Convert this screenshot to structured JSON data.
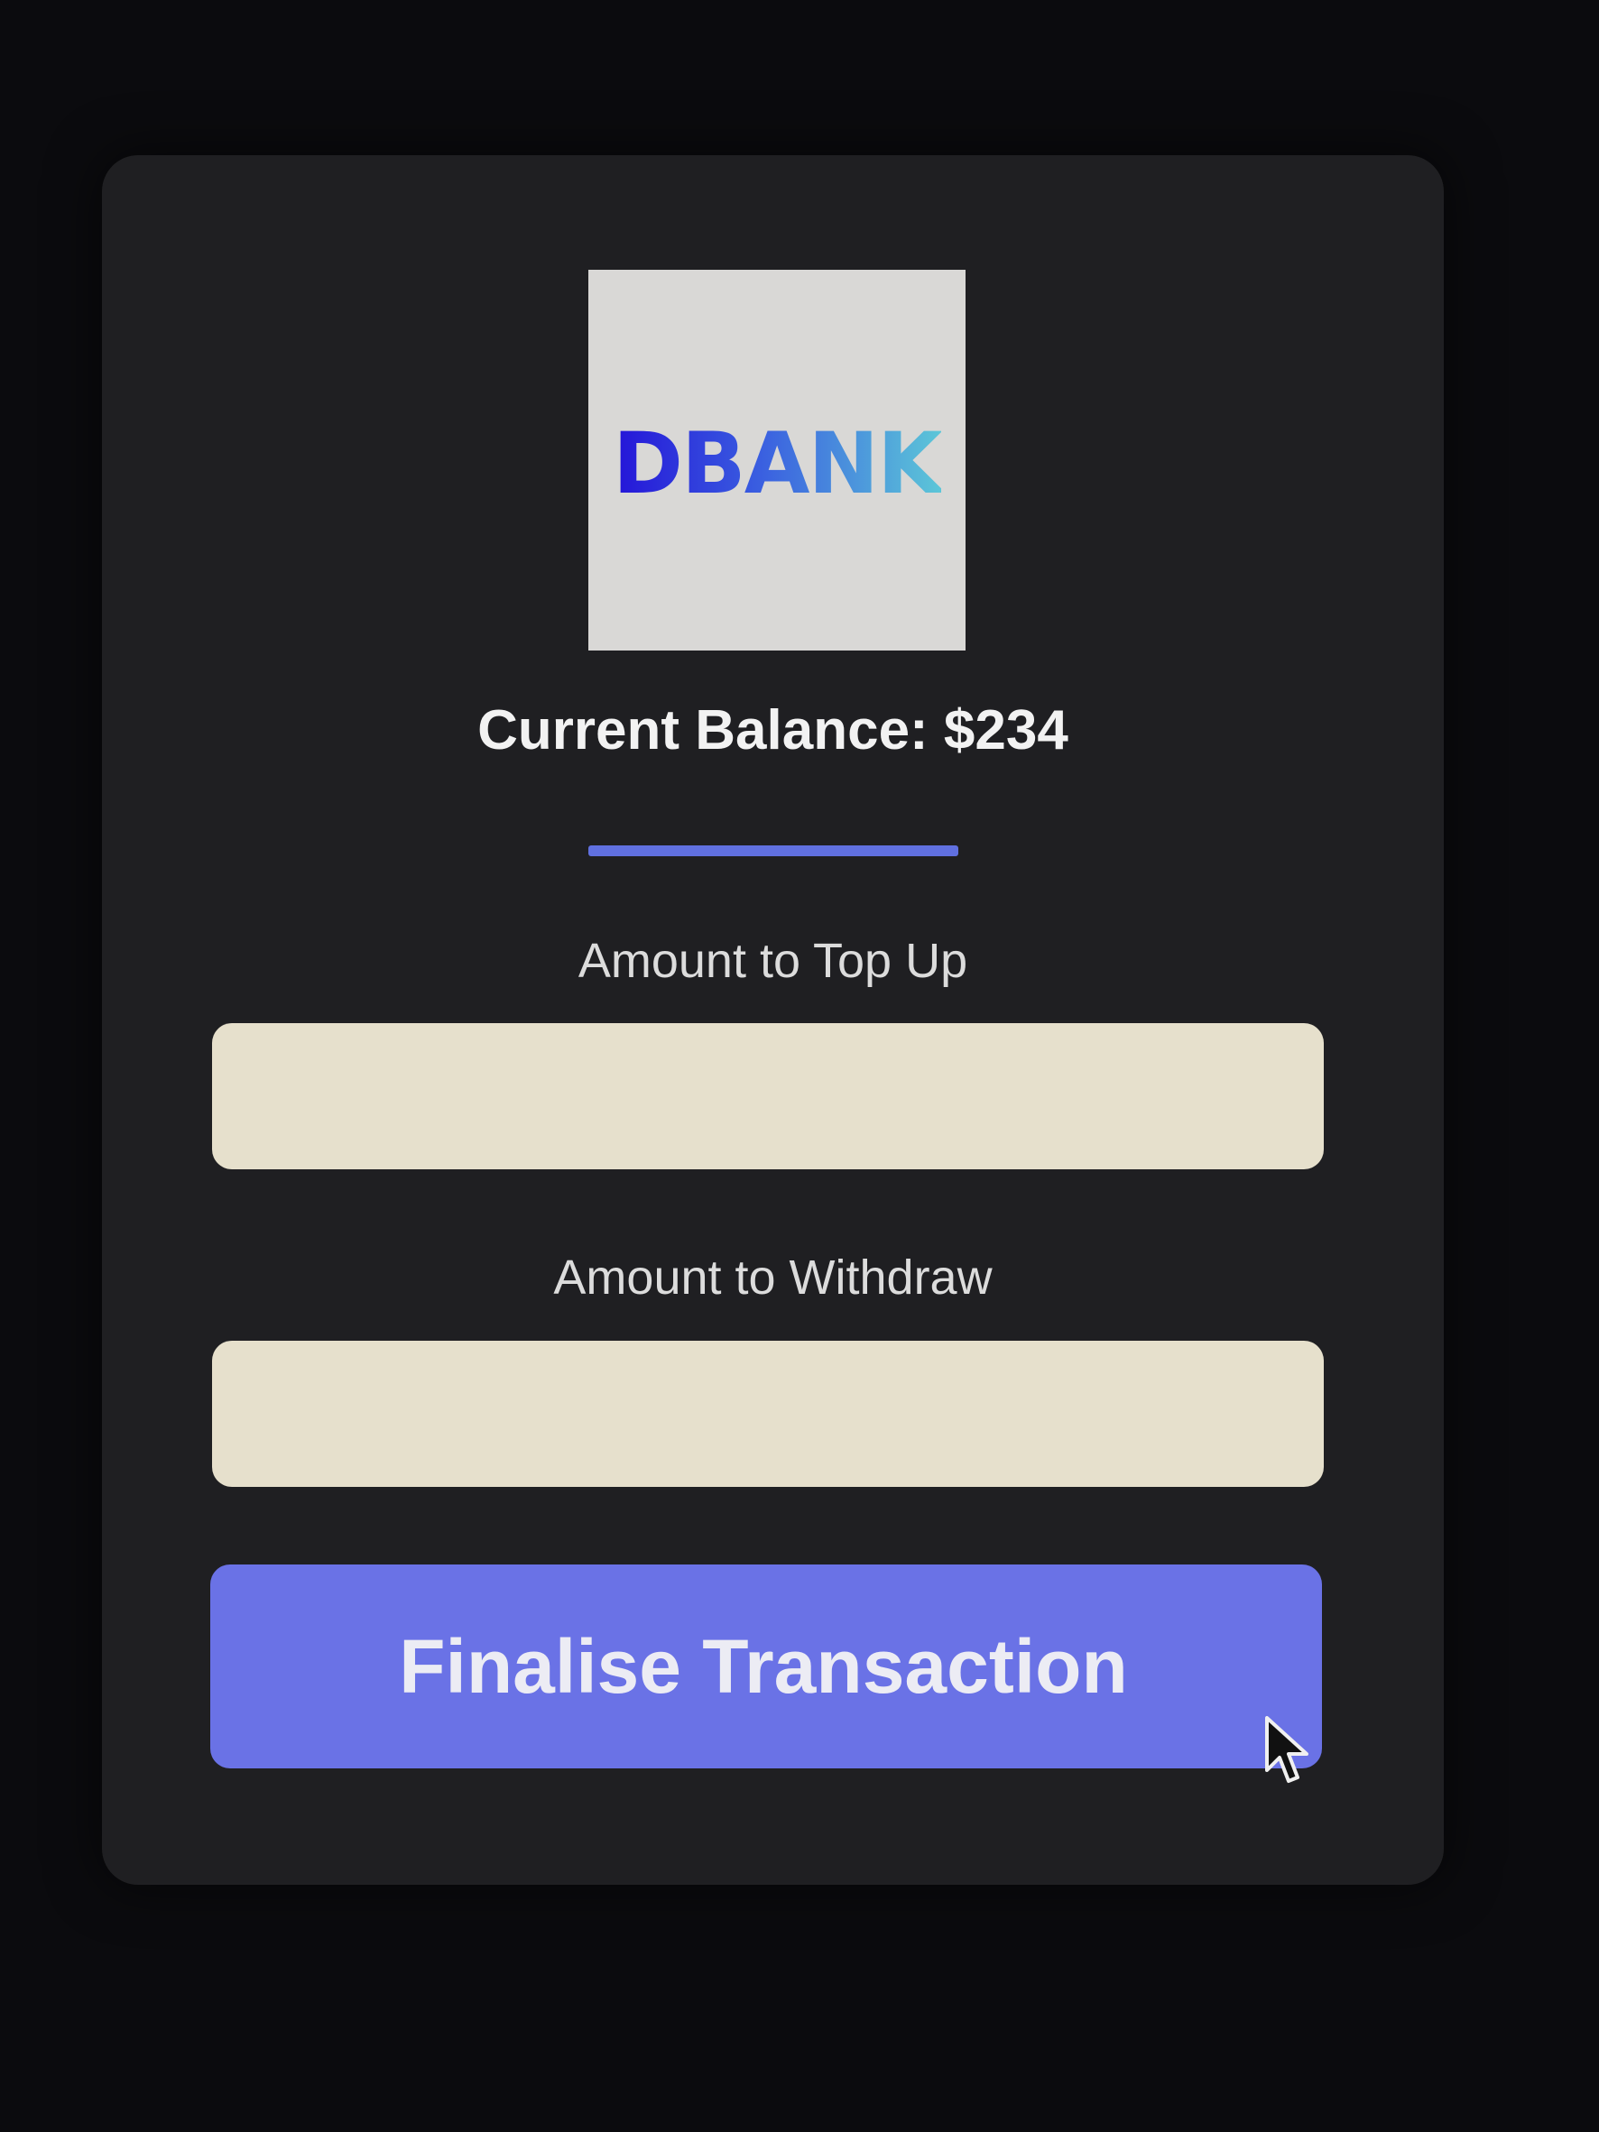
{
  "logo": {
    "text": "DBANK"
  },
  "balance": {
    "text": "Current Balance: $234",
    "amount": 234
  },
  "form": {
    "topup_label": "Amount to Top Up",
    "topup_value": "",
    "withdraw_label": "Amount to Withdraw",
    "withdraw_value": "",
    "submit_label": "Finalise Transaction"
  },
  "icons": {
    "cursor": "mouse-pointer-icon"
  },
  "colors": {
    "background": "#0b0b0e",
    "card": "#1f1f22",
    "accent": "#6a72e6",
    "divider": "#6070e0",
    "input_bg": "#e6e0cc",
    "logo_bg": "#d9d8d6"
  }
}
